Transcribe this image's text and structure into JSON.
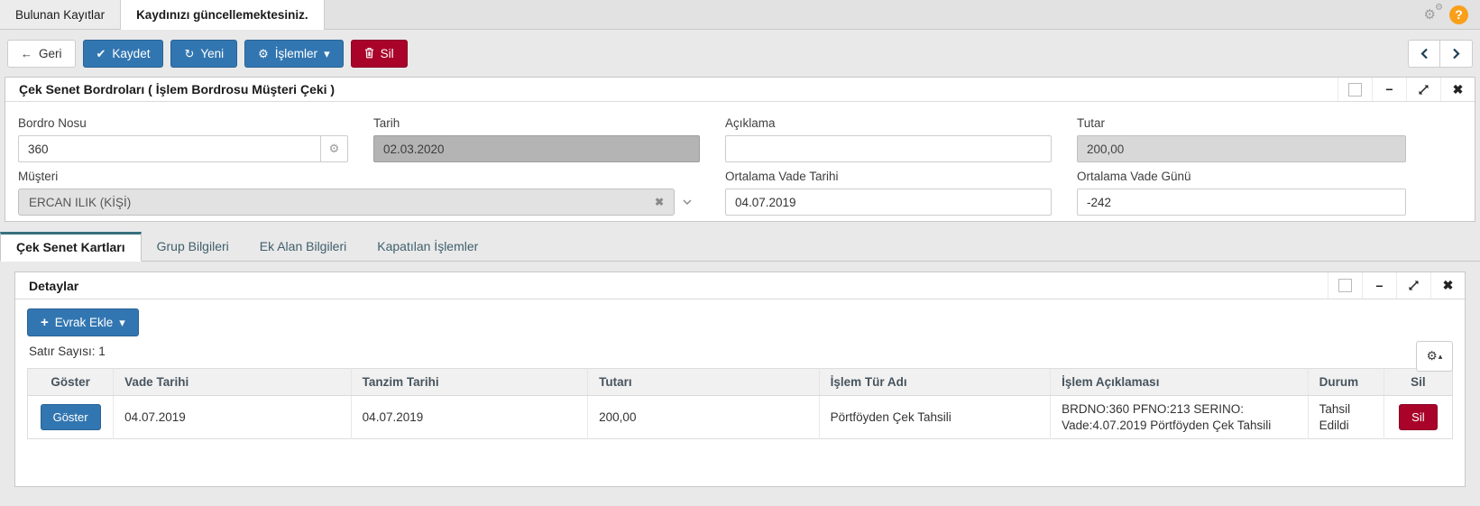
{
  "window_tabs": [
    {
      "label": "Bulunan Kayıtlar"
    },
    {
      "label": "Kaydınızı güncellemektesiniz."
    }
  ],
  "icons": {
    "back_arrow": "←",
    "check": "✔",
    "refresh": "↻",
    "gear": "⚙",
    "caret_down": "▾",
    "caret_up": "▴",
    "minimize": "−",
    "close": "✖",
    "clear": "✖",
    "plus": "+",
    "question": "?"
  },
  "toolbar": {
    "back_label": "Geri",
    "save_label": "Kaydet",
    "new_label": "Yeni",
    "operations_label": "İşlemler",
    "delete_label": "Sil"
  },
  "bordro_panel": {
    "title": "Çek Senet Bordroları ( İşlem Bordrosu Müşteri Çeki )"
  },
  "form": {
    "bordro_nosu": {
      "label": "Bordro Nosu",
      "value": "360"
    },
    "tarih": {
      "label": "Tarih",
      "value": "02.03.2020"
    },
    "aciklama": {
      "label": "Açıklama",
      "value": ""
    },
    "tutar": {
      "label": "Tutar",
      "value": "200,00"
    },
    "musteri": {
      "label": "Müşteri",
      "value": "ERCAN ILIK (KİŞİ)"
    },
    "ortalama_vade_tarihi": {
      "label": "Ortalama Vade Tarihi",
      "value": "04.07.2019"
    },
    "ortalama_vade_gunu": {
      "label": "Ortalama Vade Günü",
      "value": "-242"
    }
  },
  "subtabs": [
    {
      "label": "Çek Senet Kartları"
    },
    {
      "label": "Grup Bilgileri"
    },
    {
      "label": "Ek Alan Bilgileri"
    },
    {
      "label": "Kapatılan İşlemler"
    }
  ],
  "details": {
    "title": "Detaylar",
    "add_document_label": "Evrak Ekle",
    "row_count_text": "Satır Sayısı: 1",
    "table": {
      "headers": [
        "Göster",
        "Vade Tarihi",
        "Tanzim Tarihi",
        "Tutarı",
        "İşlem Tür Adı",
        "İşlem Açıklaması",
        "Durum",
        "Sil"
      ],
      "rows": [
        {
          "goster_label": "Göster",
          "vade_tarihi": "04.07.2019",
          "tanzim_tarihi": "04.07.2019",
          "tutari": "200,00",
          "islem_tur_adi": "Pörtföyden Çek Tahsili",
          "islem_aciklamasi": "BRDNO:360 PFNO:213 SERINO: Vade:4.07.2019 Pörtföyden Çek Tahsili",
          "durum": "Tahsil Edildi",
          "sil_label": "Sil"
        }
      ]
    }
  },
  "colors": {
    "primary_blue": "#3276b1",
    "danger_red": "#a90329",
    "tab_accent_teal": "#38707e",
    "help_orange": "#f9a01b"
  }
}
